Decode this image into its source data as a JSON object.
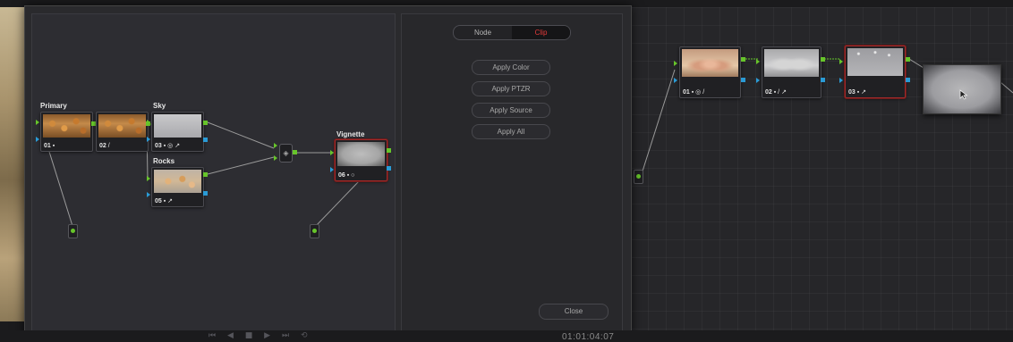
{
  "popup": {
    "tabs": [
      {
        "label": "Node",
        "active": false
      },
      {
        "label": "Clip",
        "active": true
      }
    ],
    "actions": [
      "Apply Color",
      "Apply PTZR",
      "Apply Source",
      "Apply All"
    ],
    "close_label": "Close",
    "nodes": {
      "n01": {
        "label": "Primary",
        "number": "01",
        "icons": "▪"
      },
      "n02": {
        "label": "",
        "number": "02",
        "icons": "/"
      },
      "n03": {
        "label": "Sky",
        "number": "03",
        "icons": "▪ ◎ ↗"
      },
      "n05": {
        "label": "Rocks",
        "number": "05",
        "icons": "▪ ↗"
      },
      "n06": {
        "label": "Vignette",
        "number": "06",
        "icons": "▪ ○"
      }
    }
  },
  "right_graph": {
    "nodes": {
      "n01": {
        "number": "01",
        "icons": "▪ ◎ /"
      },
      "n02": {
        "number": "02",
        "icons": "▪ / ↗"
      },
      "n03": {
        "number": "03",
        "icons": "▪ ↗"
      }
    }
  },
  "timeline": {
    "timecode": "01:01:04:07",
    "transport": [
      "⏮",
      "◀",
      "■",
      "▶",
      "⏭",
      "⟲"
    ]
  },
  "colors": {
    "accent_red": "#e53a3a",
    "port_green": "#67c52a",
    "port_blue": "#2a9bd6",
    "selected_border": "#a02a2a"
  },
  "icons": {
    "mixer": "layer-mixer-icon",
    "cursor": "mouse-pointer-icon"
  }
}
